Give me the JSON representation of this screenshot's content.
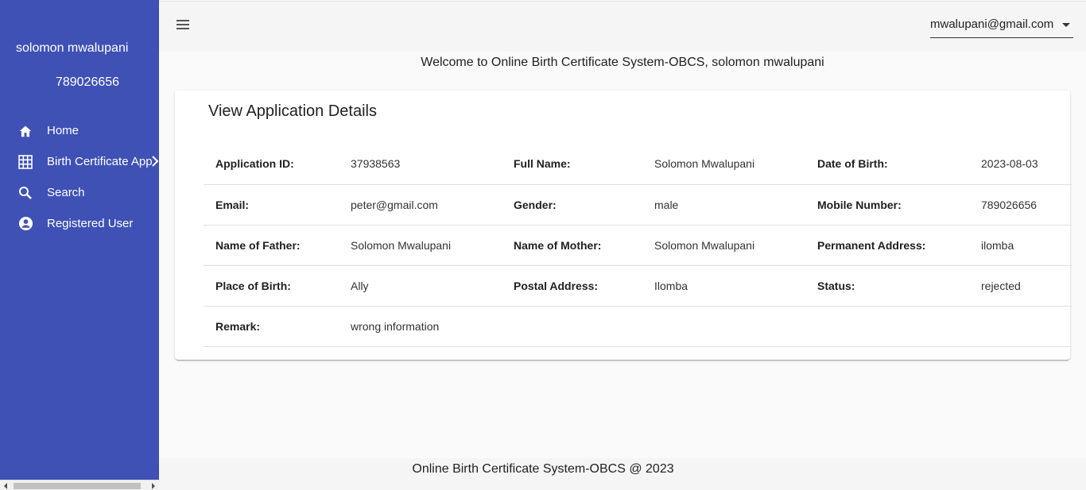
{
  "sidebar": {
    "user_name": "solomon mwalupani",
    "user_phone": "789026656",
    "items": [
      {
        "label": "Home",
        "icon": "home-icon"
      },
      {
        "label": "Birth Certificate App",
        "icon": "grid-icon"
      },
      {
        "label": "Search",
        "icon": "search-icon"
      },
      {
        "label": "Registered User",
        "icon": "account-circle-icon"
      }
    ]
  },
  "header": {
    "account_email": "mwalupani@gmail.com"
  },
  "welcome_text": "Welcome to Online Birth Certificate System-OBCS, solomon mwalupani",
  "card": {
    "title": "View Application Details",
    "rows": [
      [
        {
          "k": "Application ID:",
          "v": "37938563"
        },
        {
          "k": "Full Name:",
          "v": "Solomon Mwalupani"
        },
        {
          "k": "Date of Birth:",
          "v": "2023-08-03"
        }
      ],
      [
        {
          "k": "Email:",
          "v": "peter@gmail.com"
        },
        {
          "k": "Gender:",
          "v": "male"
        },
        {
          "k": "Mobile Number:",
          "v": "789026656"
        }
      ],
      [
        {
          "k": "Name of Father:",
          "v": "Solomon Mwalupani"
        },
        {
          "k": "Name of Mother:",
          "v": "Solomon Mwalupani"
        },
        {
          "k": "Permanent Address:",
          "v": "ilomba"
        }
      ],
      [
        {
          "k": "Place of Birth:",
          "v": "Ally"
        },
        {
          "k": "Postal Address:",
          "v": "Ilomba"
        },
        {
          "k": "Status:",
          "v": "rejected"
        }
      ],
      [
        {
          "k": "Remark:",
          "v": "wrong information"
        }
      ]
    ]
  },
  "footer": {
    "text": "Online Birth Certificate System-OBCS @ 2023"
  },
  "colors": {
    "sidebar_bg": "#3f51b5",
    "topbar_bg": "#f5f5f5"
  }
}
